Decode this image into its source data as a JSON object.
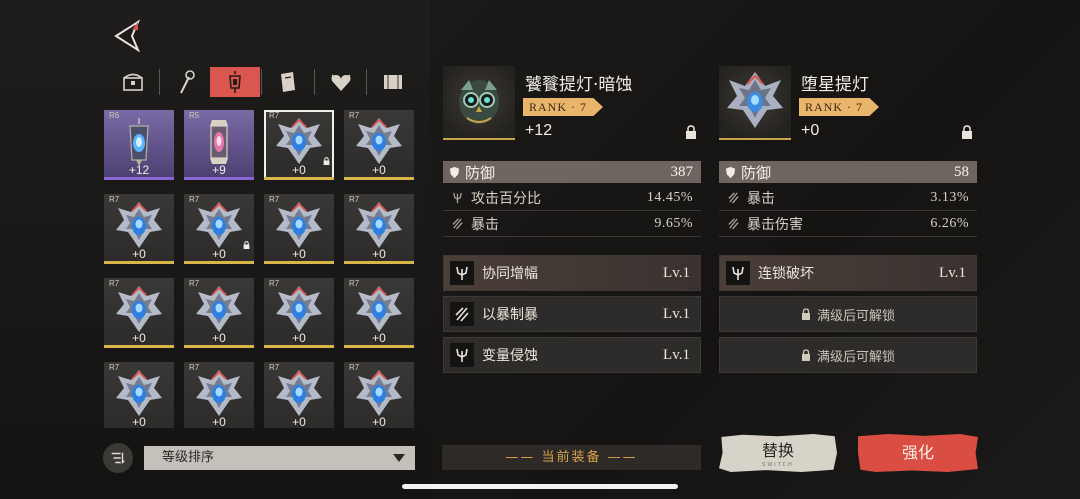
{
  "sort": {
    "label": "等级排序"
  },
  "grid": {
    "items": [
      {
        "rank": "R6",
        "plus": "+12",
        "style": "purple",
        "kind": "lantern-blue",
        "selected": false,
        "locked": false
      },
      {
        "rank": "R5",
        "plus": "+9",
        "style": "purple",
        "kind": "lantern-pink",
        "selected": false,
        "locked": false
      },
      {
        "rank": "R7",
        "plus": "+0",
        "style": "gray",
        "kind": "star-lamp",
        "selected": true,
        "locked": true
      },
      {
        "rank": "R7",
        "plus": "+0",
        "style": "gray",
        "kind": "star-lamp",
        "selected": false,
        "locked": false
      },
      {
        "rank": "R7",
        "plus": "+0",
        "style": "gray",
        "kind": "star-lamp",
        "selected": false,
        "locked": false
      },
      {
        "rank": "R7",
        "plus": "+0",
        "style": "gray",
        "kind": "star-lamp",
        "selected": false,
        "locked": true
      },
      {
        "rank": "R7",
        "plus": "+0",
        "style": "gray",
        "kind": "star-lamp",
        "selected": false,
        "locked": false
      },
      {
        "rank": "R7",
        "plus": "+0",
        "style": "gray",
        "kind": "star-lamp",
        "selected": false,
        "locked": false
      },
      {
        "rank": "R7",
        "plus": "+0",
        "style": "gray",
        "kind": "star-lamp",
        "selected": false,
        "locked": false
      },
      {
        "rank": "R7",
        "plus": "+0",
        "style": "gray",
        "kind": "star-lamp",
        "selected": false,
        "locked": false
      },
      {
        "rank": "R7",
        "plus": "+0",
        "style": "gray",
        "kind": "star-lamp",
        "selected": false,
        "locked": false
      },
      {
        "rank": "R7",
        "plus": "+0",
        "style": "gray",
        "kind": "star-lamp",
        "selected": false,
        "locked": false
      },
      {
        "rank": "R7",
        "plus": "+0",
        "style": "gray",
        "kind": "star-lamp",
        "selected": false,
        "locked": false
      },
      {
        "rank": "R7",
        "plus": "+0",
        "style": "gray",
        "kind": "star-lamp",
        "selected": false,
        "locked": false
      },
      {
        "rank": "R7",
        "plus": "+0",
        "style": "gray",
        "kind": "star-lamp",
        "selected": false,
        "locked": false
      },
      {
        "rank": "R7",
        "plus": "+0",
        "style": "gray",
        "kind": "star-lamp",
        "selected": false,
        "locked": false
      }
    ]
  },
  "equipped": {
    "name": "饕餮提灯·暗蚀",
    "rank": "RANK · 7",
    "plus": "+12",
    "main_stat": {
      "label": "防御",
      "value": "387"
    },
    "sub_stats": [
      {
        "label": "攻击百分比",
        "value": "14.45%"
      },
      {
        "label": "暴击",
        "value": "9.65%"
      }
    ],
    "skills": [
      {
        "name": "协同增幅",
        "level": "Lv.1"
      },
      {
        "name": "以暴制暴",
        "level": "Lv.1"
      },
      {
        "name": "变量侵蚀",
        "level": "Lv.1"
      }
    ],
    "status_label": "当前装备"
  },
  "candidate": {
    "name": "堕星提灯",
    "rank": "RANK · 7",
    "plus": "+0",
    "main_stat": {
      "label": "防御",
      "value": "58"
    },
    "sub_stats": [
      {
        "label": "暴击",
        "value": "3.13%"
      },
      {
        "label": "暴击伤害",
        "value": "6.26%"
      }
    ],
    "skills": [
      {
        "name": "连锁破坏",
        "level": "Lv.1"
      }
    ],
    "locked_skill_label": "满级后可解锁",
    "replace_label": "替换",
    "replace_deco": "SWITCH",
    "upgrade_label": "强化"
  },
  "colors": {
    "accent_red": "#d9574f",
    "gold": "#d8b647",
    "rank_tag": "#e8b56a",
    "purple": "#8a66d6"
  }
}
